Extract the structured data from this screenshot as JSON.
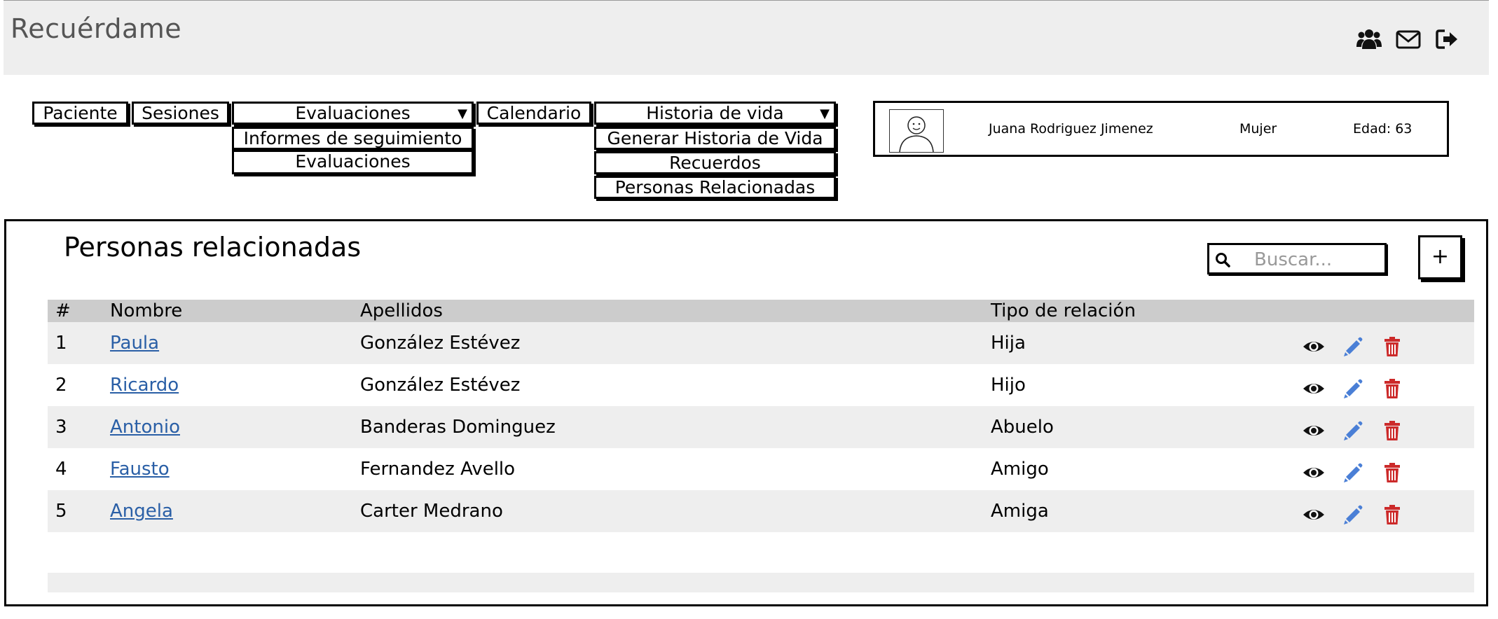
{
  "header": {
    "app_title": "Recuérdame",
    "icons": [
      "users-icon",
      "envelope-icon",
      "sign-out-icon"
    ]
  },
  "nav": {
    "paciente": "Paciente",
    "sesiones": "Sesiones",
    "evaluaciones": "Evaluaciones",
    "evaluaciones_menu": [
      "Informes de seguimiento",
      "Evaluaciones"
    ],
    "calendario": "Calendario",
    "historia": "Historia de vida",
    "historia_menu": [
      "Generar Historia de Vida",
      "Recuerdos",
      "Personas Relacionadas"
    ],
    "caret": "▼"
  },
  "patient": {
    "name": "Juana Rodriguez Jimenez",
    "gender": "Mujer",
    "age": "Edad: 63"
  },
  "panel": {
    "title": "Personas relacionadas",
    "search_placeholder": "Buscar...",
    "add_label": "+"
  },
  "table": {
    "headers": [
      "#",
      "Nombre",
      "Apellidos",
      "Tipo de relación"
    ],
    "rows": [
      {
        "num": "1",
        "name": "Paula",
        "last": "González Estévez",
        "rel": "Hija"
      },
      {
        "num": "2",
        "name": "Ricardo",
        "last": "González Estévez",
        "rel": "Hijo"
      },
      {
        "num": "3",
        "name": "Antonio",
        "last": "Banderas Dominguez",
        "rel": "Abuelo"
      },
      {
        "num": "4",
        "name": "Fausto",
        "last": "Fernandez Avello",
        "rel": "Amigo"
      },
      {
        "num": "5",
        "name": "Angela",
        "last": "Carter Medrano",
        "rel": "Amiga"
      }
    ],
    "action_icons": [
      "eye-icon",
      "pencil-icon",
      "trash-icon"
    ]
  },
  "colors": {
    "link": "#2a5fa6",
    "edit": "#4a7fd6",
    "delete": "#cc2a2a",
    "header_bg": "#eeeeee",
    "table_head": "#cccccc"
  }
}
